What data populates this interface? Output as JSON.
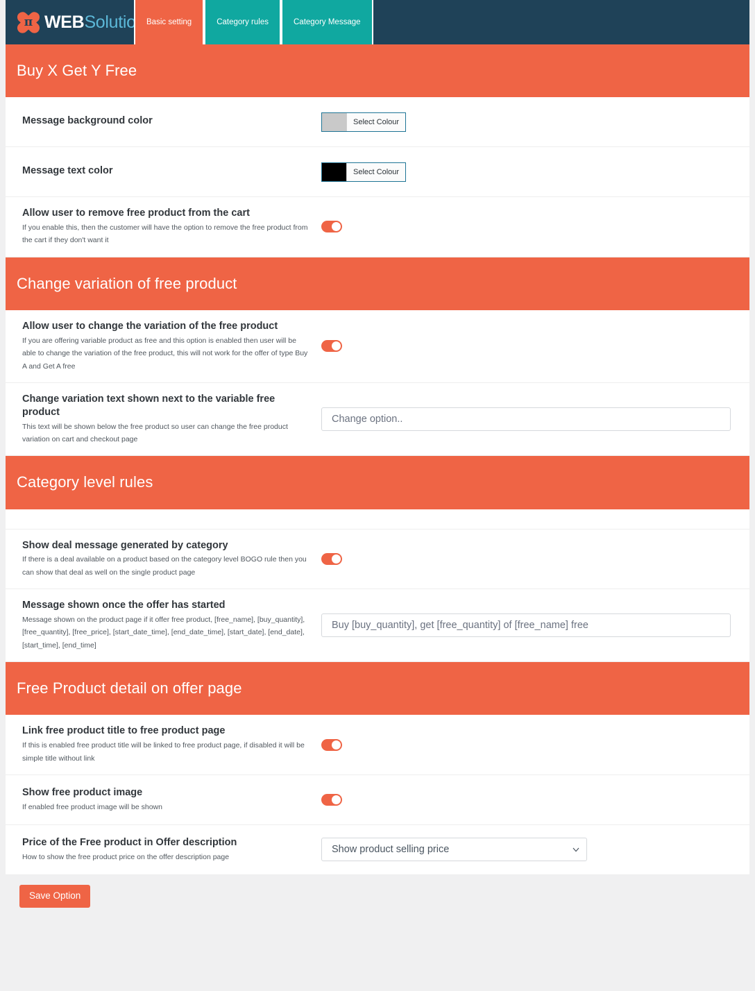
{
  "brand": {
    "logo_icon": "x-pi-logo-icon",
    "pi_symbol": "π",
    "name_bold": "WEB",
    "name_light": "Solution"
  },
  "nav": {
    "tabs": [
      {
        "label": "Basic setting",
        "active": true
      },
      {
        "label": "Category rules",
        "active": false
      },
      {
        "label": "Category Message",
        "active": false
      }
    ]
  },
  "colors": {
    "accent_orange": "#ef6445",
    "teal": "#10a8a0",
    "navy": "#1f4258",
    "page_bg": "#f0f0f1"
  },
  "sections": [
    {
      "title": "Buy X Get Y Free",
      "rows": [
        {
          "title": "Message background color",
          "desc": "",
          "control": "color",
          "swatch": "#c9c9c9",
          "button_label": "Select Colour"
        },
        {
          "title": "Message text color",
          "desc": "",
          "control": "color",
          "swatch": "#000000",
          "button_label": "Select Colour"
        },
        {
          "title": "Allow user to remove free product from the cart",
          "desc": "If you enable this, then the customer will have the option to remove the free product from the cart if they don't want it",
          "control": "toggle",
          "toggle_on": true
        }
      ]
    },
    {
      "title": "Change variation of free product",
      "rows": [
        {
          "title": "Allow user to change the variation of the free product",
          "desc": "If you are offering variable product as free and this option is enabled then user will be able to change the variation of the free product, this will not work for the offer of type Buy A and Get A free",
          "control": "toggle",
          "toggle_on": true
        },
        {
          "title": "Change variation text shown next to the variable free product",
          "desc": "This text will be shown below the free product so user can change the free product variation on cart and checkout page",
          "control": "text",
          "value": "",
          "placeholder": "Change option.."
        }
      ]
    },
    {
      "title": "Category level rules",
      "rows": [
        {
          "title": "",
          "desc": "",
          "control": "none",
          "blank": true
        },
        {
          "title": "Show deal message generated by category",
          "desc": "If there is a deal available on a product based on the category level BOGO rule then you can show that deal as well on the single product page",
          "control": "toggle",
          "toggle_on": true
        },
        {
          "title": "Message shown once the offer has started",
          "desc": "Message shown on the product page if it offer free product, [free_name], [buy_quantity], [free_quantity], [free_price], [start_date_time], [end_date_time], [start_date], [end_date], [start_time], [end_time]",
          "control": "text",
          "value": "",
          "placeholder": "Buy [buy_quantity], get [free_quantity] of [free_name] free"
        }
      ]
    },
    {
      "title": "Free Product detail on offer page",
      "rows": [
        {
          "title": "Link free product title to free product page",
          "desc": "If this is enabled free product title will be linked to free product page, if disabled it will be simple title without link",
          "control": "toggle",
          "toggle_on": true
        },
        {
          "title": "Show free product image",
          "desc": "If enabled free product image will be shown",
          "control": "toggle",
          "toggle_on": true
        },
        {
          "title": "Price of the Free product in Offer description",
          "desc": "How to show the free product price on the offer description page",
          "control": "select",
          "selected": "Show product selling price",
          "options": [
            "Show product selling price"
          ],
          "chevron_icon": "chevron-down-icon"
        }
      ]
    }
  ],
  "footer": {
    "save_label": "Save Option"
  }
}
